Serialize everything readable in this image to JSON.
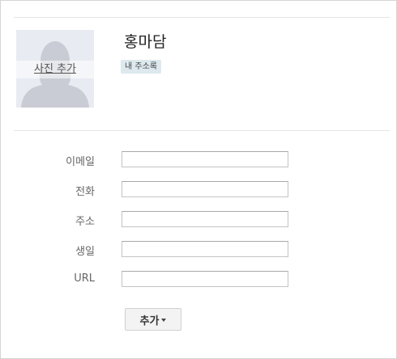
{
  "contact": {
    "name": "홍마담",
    "label": "내 주소록",
    "photo_action": "사진 추가"
  },
  "fields": [
    {
      "label": "이메일",
      "value": ""
    },
    {
      "label": "전화",
      "value": ""
    },
    {
      "label": "주소",
      "value": ""
    },
    {
      "label": "생일",
      "value": ""
    },
    {
      "label": "URL",
      "value": ""
    }
  ],
  "add_button": {
    "label": "추가",
    "icon": "chevron-down-icon"
  }
}
